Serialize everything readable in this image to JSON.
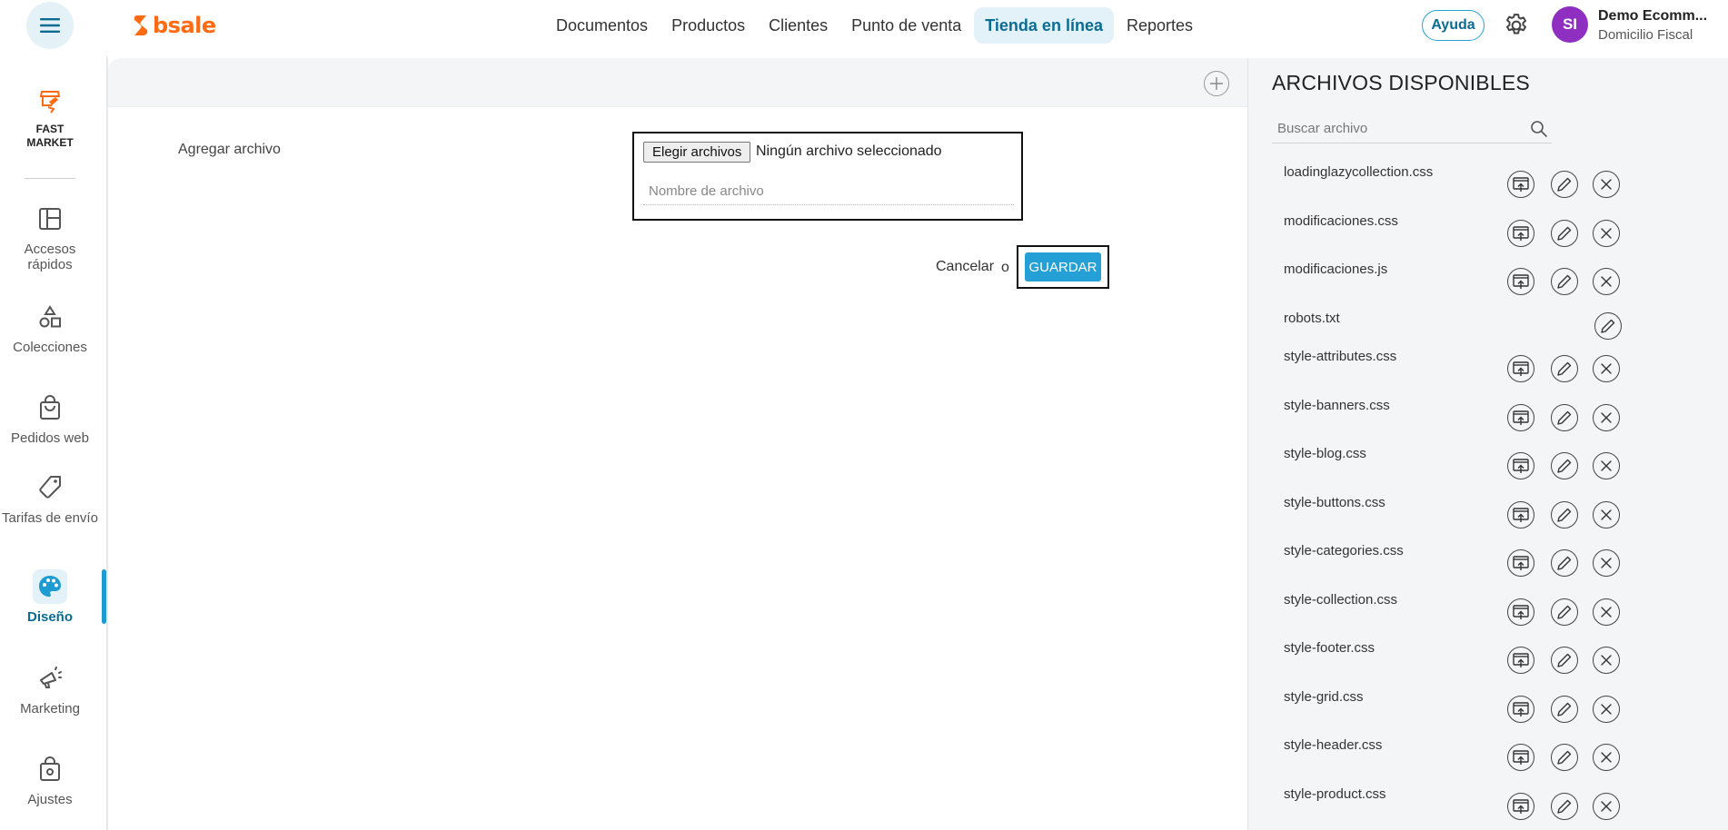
{
  "topbar": {
    "logo_text": "bsale",
    "nav": [
      "Documentos",
      "Productos",
      "Clientes",
      "Punto de venta",
      "Tienda en línea",
      "Reportes"
    ],
    "active_nav": "Tienda en línea",
    "help_label": "Ayuda",
    "avatar_initials": "SI",
    "account_name": "Demo Ecomm...",
    "account_sub": "Domicilio Fiscal"
  },
  "sidebar": {
    "store_name_line1": "FAST",
    "store_name_line2": "MARKET",
    "items": [
      {
        "label": "Accesos rápidos",
        "icon": "layout-icon"
      },
      {
        "label": "Colecciones",
        "icon": "shapes-icon"
      },
      {
        "label": "Pedidos web",
        "icon": "shopping-bag-icon"
      },
      {
        "label": "Tarifas de envío",
        "icon": "tag-icon"
      },
      {
        "label": "Diseño",
        "icon": "palette-icon",
        "active": true
      },
      {
        "label": "Marketing",
        "icon": "megaphone-icon"
      },
      {
        "label": "Ajustes",
        "icon": "settings-bag-icon"
      }
    ],
    "accent_color": "#0b6b93"
  },
  "main": {
    "add_file_label": "Agregar archivo",
    "choose_files_label": "Elegir archivos",
    "no_file_text": "Ningún archivo seleccionado",
    "filename_placeholder": "Nombre de archivo",
    "cancel_label": "Cancelar",
    "or_text": "o",
    "save_label": "GUARDAR",
    "save_color": "#25a0d6"
  },
  "files_panel": {
    "title": "ARCHIVOS DISPONIBLES",
    "search_placeholder": "Buscar archivo",
    "files": [
      {
        "name": "loadinglazycollection.css",
        "actions": [
          "upload",
          "edit",
          "delete"
        ]
      },
      {
        "name": "modificaciones.css",
        "actions": [
          "upload",
          "edit",
          "delete"
        ]
      },
      {
        "name": "modificaciones.js",
        "actions": [
          "upload",
          "edit",
          "delete"
        ]
      },
      {
        "name": "robots.txt",
        "actions": [
          "edit"
        ]
      },
      {
        "name": "style-attributes.css",
        "actions": [
          "upload",
          "edit",
          "delete"
        ]
      },
      {
        "name": "style-banners.css",
        "actions": [
          "upload",
          "edit",
          "delete"
        ]
      },
      {
        "name": "style-blog.css",
        "actions": [
          "upload",
          "edit",
          "delete"
        ]
      },
      {
        "name": "style-buttons.css",
        "actions": [
          "upload",
          "edit",
          "delete"
        ]
      },
      {
        "name": "style-categories.css",
        "actions": [
          "upload",
          "edit",
          "delete"
        ]
      },
      {
        "name": "style-collection.css",
        "actions": [
          "upload",
          "edit",
          "delete"
        ]
      },
      {
        "name": "style-footer.css",
        "actions": [
          "upload",
          "edit",
          "delete"
        ]
      },
      {
        "name": "style-grid.css",
        "actions": [
          "upload",
          "edit",
          "delete"
        ]
      },
      {
        "name": "style-header.css",
        "actions": [
          "upload",
          "edit",
          "delete"
        ]
      },
      {
        "name": "style-product.css",
        "actions": [
          "upload",
          "edit",
          "delete"
        ]
      }
    ]
  }
}
